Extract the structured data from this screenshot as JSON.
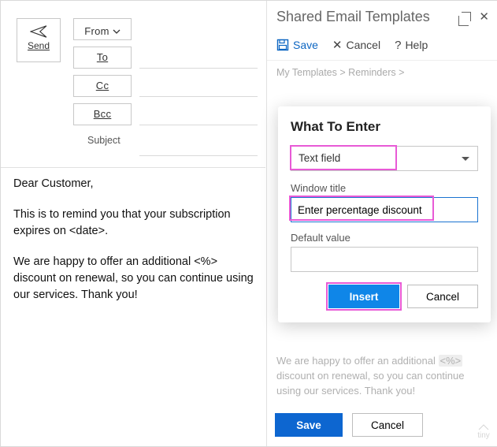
{
  "compose": {
    "send_label": "Send",
    "from_label": "From",
    "to_label": "To",
    "cc_label": "Cc",
    "bcc_label": "Bcc",
    "subject_label": "Subject"
  },
  "email_body": {
    "greeting": "Dear Customer,",
    "p1": "This is to remind you that your subscription expires on <date>.",
    "p2": "We are happy to offer an additional <%> discount on renewal, so you can continue using our services. Thank you!"
  },
  "pane": {
    "title": "Shared Email Templates",
    "save": "Save",
    "cancel": "Cancel",
    "help": "Help",
    "breadcrumb": {
      "a": "My Templates",
      "b": "Reminders",
      "sep": ">"
    },
    "preview_tail_pre": "We are happy to offer an additional ",
    "preview_ph": "<%>",
    "preview_tail_post": " discount on renewal, so you can continue using our services. Thank you!"
  },
  "dialog": {
    "title": "What To Enter",
    "type_value": "Text field",
    "window_title_label": "Window title",
    "window_title_value": "Enter percentage discount",
    "default_value_label": "Default value",
    "default_value_value": "",
    "insert": "Insert",
    "cancel": "Cancel"
  },
  "bottom": {
    "save": "Save",
    "cancel": "Cancel"
  },
  "watermark": "tiny"
}
